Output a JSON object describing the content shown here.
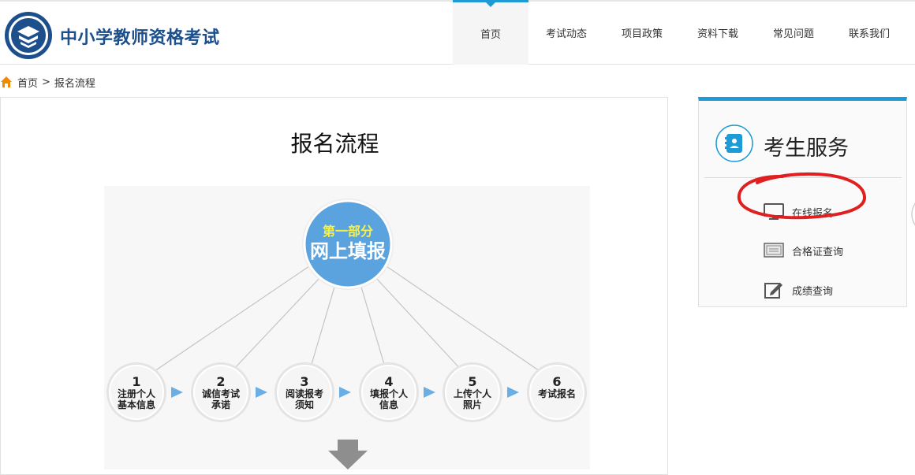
{
  "header": {
    "site_title": "中小学教师资格考试",
    "nav": [
      {
        "label": "首页",
        "active": true
      },
      {
        "label": "考试动态",
        "active": false
      },
      {
        "label": "项目政策",
        "active": false
      },
      {
        "label": "资料下载",
        "active": false
      },
      {
        "label": "常见问题",
        "active": false
      },
      {
        "label": "联系我们",
        "active": false
      }
    ]
  },
  "breadcrumb": {
    "home": "首页",
    "separator": ">",
    "current": "报名流程"
  },
  "main": {
    "title": "报名流程",
    "flow": {
      "part_label": "第一部分",
      "part_title": "网上填报",
      "steps": [
        {
          "num": "1",
          "line1": "注册个人",
          "line2": "基本信息"
        },
        {
          "num": "2",
          "line1": "诚信考试",
          "line2": "承诺"
        },
        {
          "num": "3",
          "line1": "阅读报考",
          "line2": "须知"
        },
        {
          "num": "4",
          "line1": "填报个人",
          "line2": "信息"
        },
        {
          "num": "5",
          "line1": "上传个人",
          "line2": "照片"
        },
        {
          "num": "6",
          "line1": "考试报名",
          "line2": ""
        }
      ]
    }
  },
  "sidebar": {
    "title": "考生服务",
    "items": [
      {
        "label": "在线报名",
        "icon": "monitor-icon"
      },
      {
        "label": "合格证查询",
        "icon": "certificate-icon"
      },
      {
        "label": "成绩查询",
        "icon": "edit-icon"
      }
    ]
  },
  "colors": {
    "accent": "#1e9ad6",
    "title_blue": "#1c4f8c",
    "annotation_red": "#e02020",
    "bubble_blue": "#5aa3df",
    "bubble_yellow": "#f6f14a",
    "arrow_blue": "#6aaee6"
  }
}
